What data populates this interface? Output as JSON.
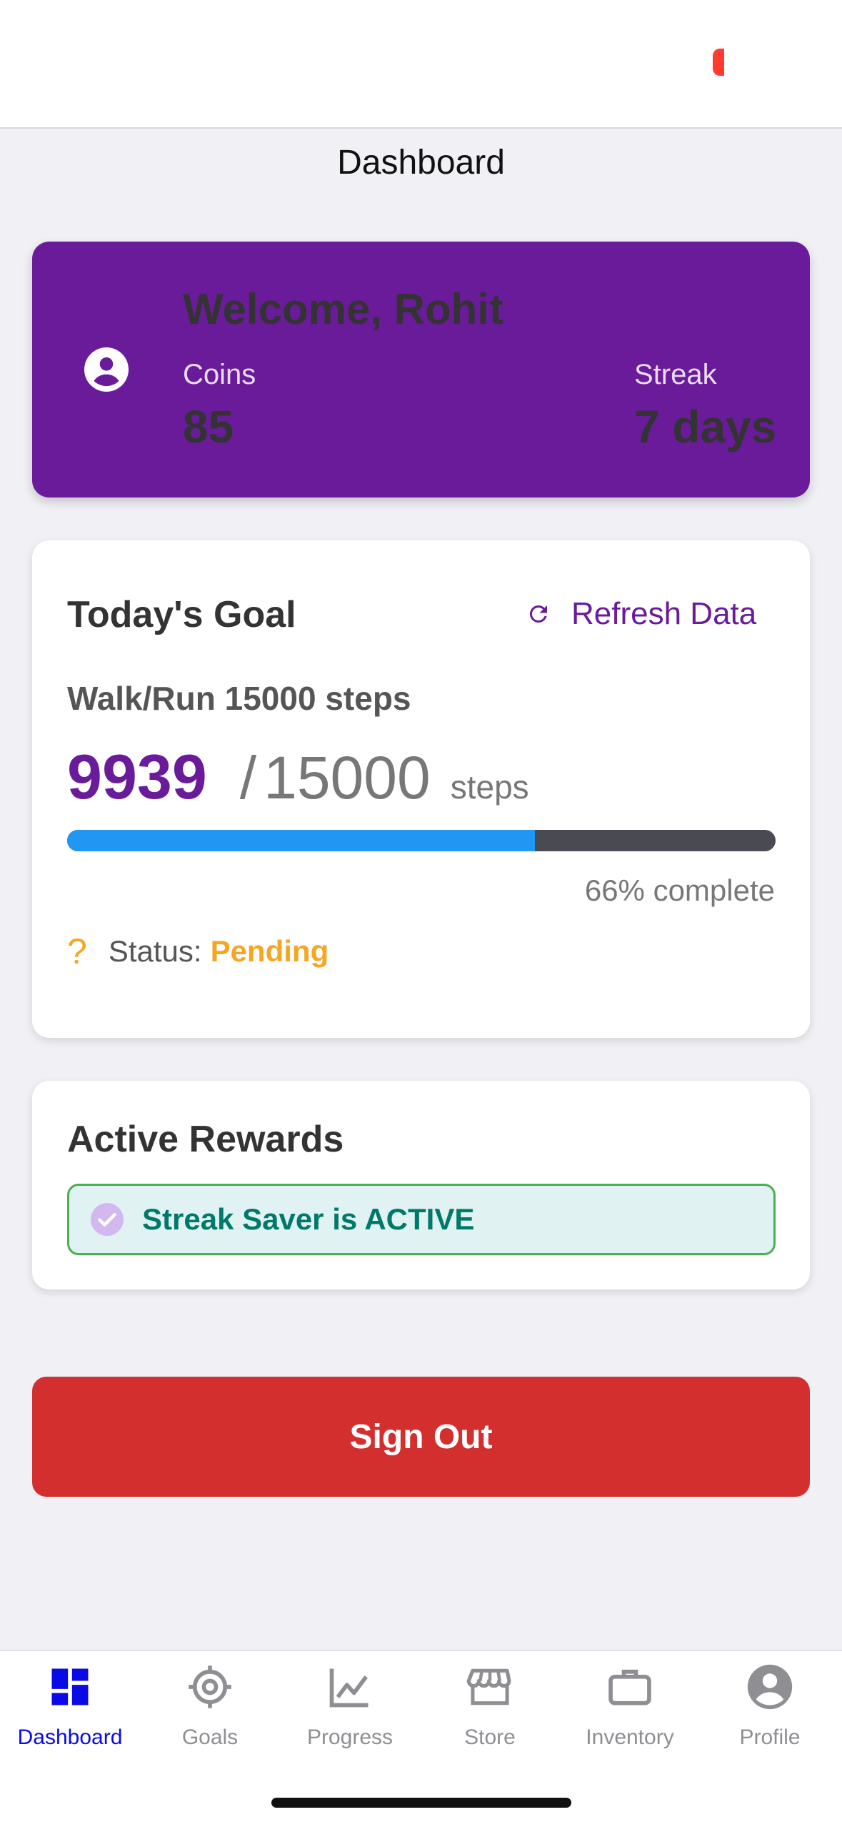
{
  "header": {
    "title": "Dashboard"
  },
  "welcome": {
    "title": "Welcome, Rohit",
    "coins_label": "Coins",
    "coins_value": "85",
    "streak_label": "Streak",
    "streak_value": "7 days"
  },
  "goal": {
    "title": "Today's Goal",
    "refresh_label": "Refresh Data",
    "description": "Walk/Run 15000 steps",
    "current_steps": "9939",
    "separator": "/",
    "target_steps": "15000",
    "unit": "steps",
    "progress_fraction": 0.66,
    "progress_text": "66% complete",
    "status_label": "Status:",
    "status_value": "Pending"
  },
  "rewards": {
    "title": "Active Rewards",
    "badge_text": "Streak Saver is ACTIVE"
  },
  "signout_label": "Sign Out",
  "tabs": [
    {
      "label": "Dashboard",
      "icon": "dashboard-icon",
      "active": true
    },
    {
      "label": "Goals",
      "icon": "crosshair-icon",
      "active": false
    },
    {
      "label": "Progress",
      "icon": "chart-line-icon",
      "active": false
    },
    {
      "label": "Store",
      "icon": "store-icon",
      "active": false
    },
    {
      "label": "Inventory",
      "icon": "briefcase-icon",
      "active": false
    },
    {
      "label": "Profile",
      "icon": "account-circle-icon",
      "active": false
    }
  ],
  "colors": {
    "primary": "#6a1b9a",
    "progress": "#2196f3",
    "danger": "#d32f2f",
    "pending": "#f5a623",
    "success": "#00796b",
    "active_tab": "#0a0ae6"
  }
}
